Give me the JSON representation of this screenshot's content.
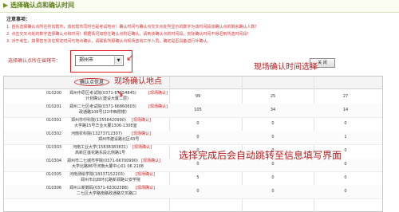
{
  "header": {
    "title": "选择确认点和确认时间",
    "notice_title": "注意事项："
  },
  "notices": [
    "1. 首先选择确认点所在的省辖市，该省辖市同时也是考试地点！确认时间与确认点交叉点处所显示的数字为该时间段该确认点的剩余确认人数！",
    "2. 点击交叉点处的数字选择确认点和时间！根据情况如想在确认点附近确认，请到该确认点的时间段，实际确认时间不得迟到所选时间段！",
    "3. 对于考生，如果您无法在规定时间与地点确认，请联系所报确认点现场咨询工作人员，确定是否具备进行补确认。"
  ],
  "selector": {
    "label": "选择确认点所在省辖市：",
    "value": "郑州市",
    "close_label": "关 闭"
  },
  "grid": {
    "info_header": "确认点信息",
    "rows": [
      {
        "code": "010200",
        "line1": "郑州中原区考试院(0371-67654845)",
        "link": "[现场确认]",
        "line2": "计划确认(建设大厦二层)",
        "values": [
          "99",
          "25",
          "27"
        ]
      },
      {
        "code": "010201",
        "line1": "郑州二七区考试院(0371-66860603)",
        "link": "[现场确认]",
        "line2": "政通路106号(22中西附楼)",
        "values": [
          "105",
          "34",
          "14"
        ]
      },
      {
        "code": "010301",
        "line1": "郑州市中科院(13558420990)",
        "link": "[现场确认]",
        "line2": "大学路15号华业大厦1306-1308室",
        "values": [
          "0",
          "0",
          "0"
        ]
      },
      {
        "code": "010302",
        "line1": "河南农科院(13273712307)",
        "link": "[现场确认]",
        "line2": "郑州市建设路北区43号",
        "values": [
          "0",
          "0",
          "1"
        ]
      },
      {
        "code": "010303",
        "line1": "河南工业大学(15838383831)",
        "link": "[现场确认]",
        "line2": "高新区莲花路东段北侧路1号",
        "values": [
          "0",
          "0",
          "0"
        ]
      },
      {
        "code": "010304",
        "line1": "郑州市二七城市学院(0371-66700990)",
        "link": "[现场确认]",
        "line2": "大学北路86号河南大厦中心01 06 2108",
        "values": [
          "0",
          "0",
          "0"
        ]
      },
      {
        "code": "010305",
        "line1": "河南测绘学院(18337152203)",
        "link": "[现场确认]",
        "line2": "郑州市北四环北路新郑路公安学院",
        "values": [
          "5",
          "0",
          "0"
        ]
      },
      {
        "code": "010306",
        "line1": "郑州三新数码(0371-63302388)",
        "link": "[现场确认]",
        "line2": "二七区大学路南路政通路交叉路口",
        "values": [
          "0",
          "0",
          "0"
        ]
      }
    ]
  },
  "annotations": {
    "left": "现场确认地点",
    "right": "现场确认时间选择",
    "bottom": "选择完成后会自动跳转至信息填写界面"
  }
}
